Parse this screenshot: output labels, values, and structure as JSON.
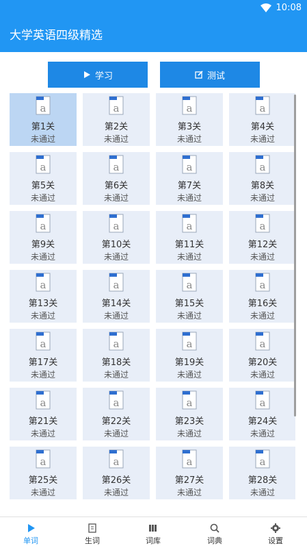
{
  "status": {
    "time": "10:08"
  },
  "appbar": {
    "title": "大学英语四级精选"
  },
  "actions": {
    "learn_label": "学习",
    "test_label": "测试"
  },
  "levels": [
    {
      "label": "第1关",
      "status": "未通过"
    },
    {
      "label": "第2关",
      "status": "未通过"
    },
    {
      "label": "第3关",
      "status": "未通过"
    },
    {
      "label": "第4关",
      "status": "未通过"
    },
    {
      "label": "第5关",
      "status": "未通过"
    },
    {
      "label": "第6关",
      "status": "未通过"
    },
    {
      "label": "第7关",
      "status": "未通过"
    },
    {
      "label": "第8关",
      "status": "未通过"
    },
    {
      "label": "第9关",
      "status": "未通过"
    },
    {
      "label": "第10关",
      "status": "未通过"
    },
    {
      "label": "第11关",
      "status": "未通过"
    },
    {
      "label": "第12关",
      "status": "未通过"
    },
    {
      "label": "第13关",
      "status": "未通过"
    },
    {
      "label": "第14关",
      "status": "未通过"
    },
    {
      "label": "第15关",
      "status": "未通过"
    },
    {
      "label": "第16关",
      "status": "未通过"
    },
    {
      "label": "第17关",
      "status": "未通过"
    },
    {
      "label": "第18关",
      "status": "未通过"
    },
    {
      "label": "第19关",
      "status": "未通过"
    },
    {
      "label": "第20关",
      "status": "未通过"
    },
    {
      "label": "第21关",
      "status": "未通过"
    },
    {
      "label": "第22关",
      "status": "未通过"
    },
    {
      "label": "第23关",
      "status": "未通过"
    },
    {
      "label": "第24关",
      "status": "未通过"
    },
    {
      "label": "第25关",
      "status": "未通过"
    },
    {
      "label": "第26关",
      "status": "未通过"
    },
    {
      "label": "第27关",
      "status": "未通过"
    },
    {
      "label": "第28关",
      "status": "未通过"
    }
  ],
  "nav": {
    "items": [
      {
        "label": "单词",
        "icon": "play-icon"
      },
      {
        "label": "生词",
        "icon": "notebook-icon"
      },
      {
        "label": "词库",
        "icon": "books-icon"
      },
      {
        "label": "词典",
        "icon": "search-icon"
      },
      {
        "label": "设置",
        "icon": "gear-icon"
      }
    ]
  },
  "colors": {
    "primary": "#2196f3",
    "button": "#1e88e5",
    "cell": "#e8eef8",
    "cell_active": "#bcd6f3"
  }
}
